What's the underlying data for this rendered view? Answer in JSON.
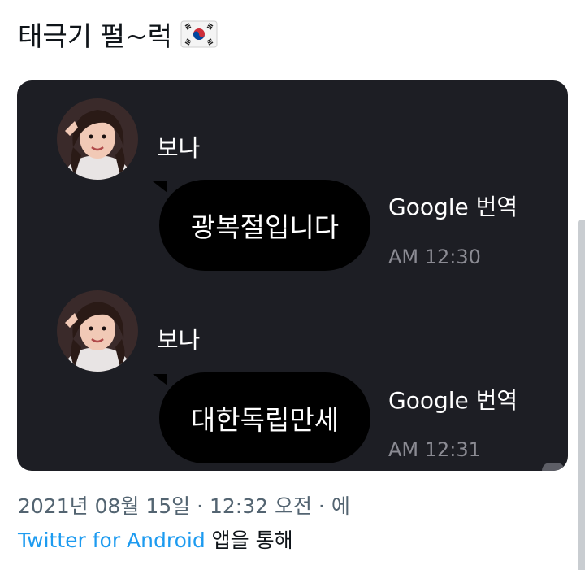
{
  "tweet": {
    "text": "태극기 펄~럭",
    "emoji": "flag-south-korea-icon"
  },
  "chat": {
    "messages": [
      {
        "sender": "보나",
        "text": "광복절입니다",
        "translate_label": "Google 번역",
        "time": "AM 12:30"
      },
      {
        "sender": "보나",
        "text": "대한독립만세",
        "translate_label": "Google 번역",
        "time": "AM 12:31"
      }
    ]
  },
  "meta": {
    "timestamp": "2021년 08월 15일 · 12:32 오전 · 에",
    "source_app": "Twitter for Android",
    "source_suffix": " 앱을 통해"
  },
  "colors": {
    "card_bg": "#1d1e24",
    "bubble_bg": "#000000",
    "link": "#1d9bf0",
    "meta_text": "#536471",
    "time_text": "#8b8b93"
  }
}
